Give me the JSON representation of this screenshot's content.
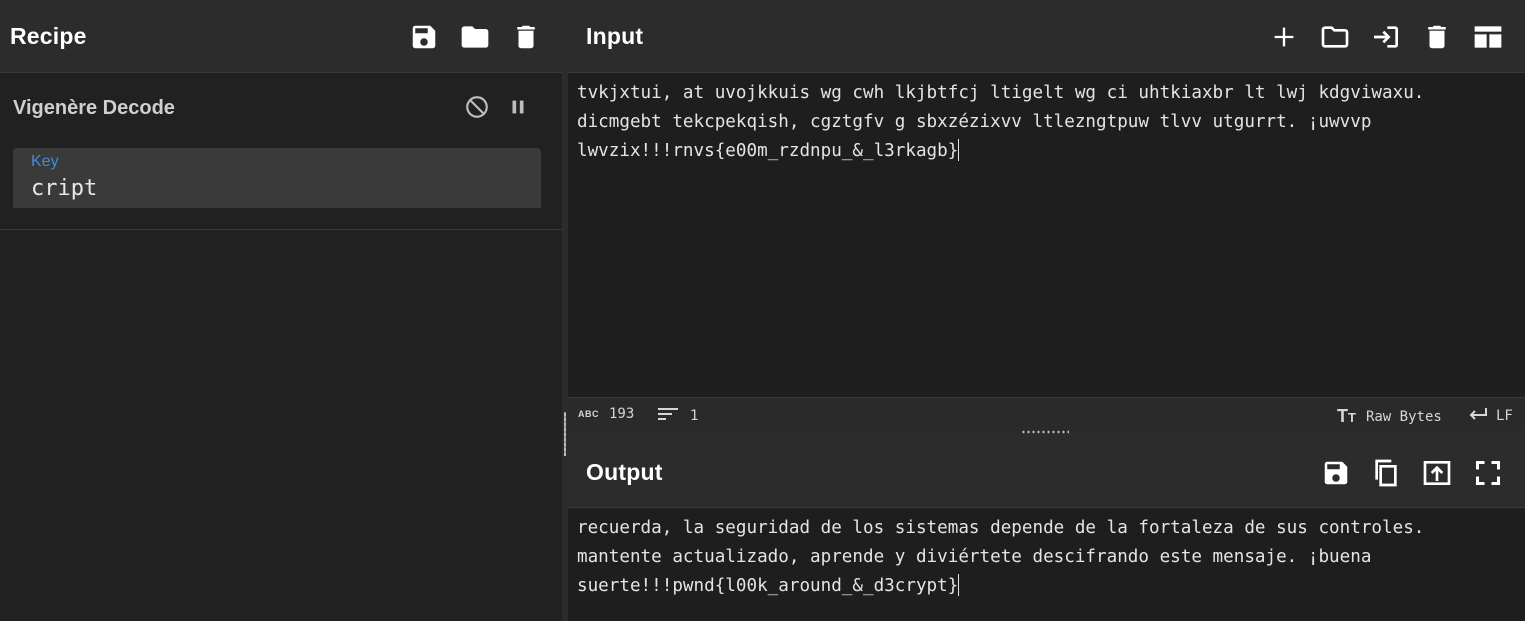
{
  "recipe": {
    "title": "Recipe",
    "icons": [
      "save-icon",
      "folder-icon",
      "trash-icon"
    ],
    "operation": {
      "name": "Vigenère Decode",
      "key_label": "Key",
      "key_value": "cript"
    }
  },
  "input": {
    "title": "Input",
    "icons": [
      "plus-icon",
      "folder-icon",
      "import-icon",
      "trash-icon",
      "layout-icon"
    ],
    "text": "tvkjxtui, at uvojkkuis wg cwh lkjbtfcj ltigelt wg ci uhtkiaxbr lt lwj kdgviwaxu. dicmgebt tekcpekqish, cgztgfv g sbxzézixvv ltlezngtpuw tlvv utgurrt. ¡uwvvp lwvzix!!!rnvs{e00m_rzdnpu_&_l3rkagb}",
    "status": {
      "char_count": "193",
      "line_count": "1",
      "encoding": "Raw Bytes",
      "eol": "LF"
    }
  },
  "output": {
    "title": "Output",
    "icons": [
      "save-icon",
      "copy-icon",
      "replace-input-icon",
      "maximize-icon"
    ],
    "text": "recuerda, la seguridad de los sistemas depende de la fortaleza de sus controles. mantente actualizado, aprende y diviértete descifrando este mensaje. ¡buena suerte!!!pwnd{l00k_around_&_d3crypt}"
  },
  "colors": {
    "header_bg": "#2c2c2c",
    "panel_bg": "#1e1e1e",
    "key_label": "#3f8fd8",
    "text": "#e4e4e4"
  }
}
